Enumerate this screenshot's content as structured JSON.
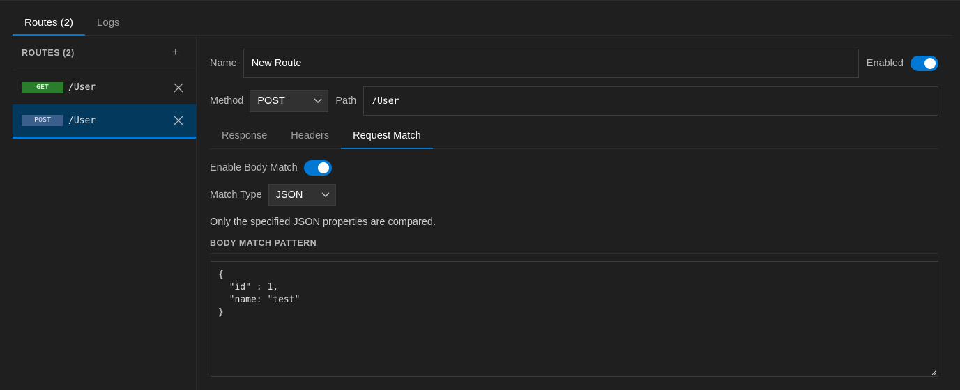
{
  "top_tabs": [
    {
      "label": "Routes (2)",
      "active": true
    },
    {
      "label": "Logs",
      "active": false
    }
  ],
  "sidebar": {
    "title": "ROUTES (2)",
    "add_label": "+",
    "routes": [
      {
        "method": "GET",
        "path": "/User",
        "selected": false
      },
      {
        "method": "POST",
        "path": "/User",
        "selected": true
      }
    ]
  },
  "route": {
    "name_label": "Name",
    "name_value": "New Route",
    "enabled_label": "Enabled",
    "enabled": true,
    "method_label": "Method",
    "method_value": "POST",
    "path_label": "Path",
    "path_value": "/User"
  },
  "sub_tabs": [
    {
      "label": "Response",
      "active": false
    },
    {
      "label": "Headers",
      "active": false
    },
    {
      "label": "Request Match",
      "active": true
    }
  ],
  "request_match": {
    "enable_body_match_label": "Enable Body Match",
    "enable_body_match": true,
    "match_type_label": "Match Type",
    "match_type_value": "JSON",
    "hint": "Only the specified JSON properties are compared.",
    "pattern_title": "BODY MATCH PATTERN",
    "pattern_value": "{\n  \"id\" : 1,\n  \"name: \"test\"\n}"
  },
  "colors": {
    "accent": "#0078d4",
    "get_badge": "#2a7d2a",
    "post_badge": "#3a5f8c",
    "selected_row": "#04395e",
    "background": "#1f1f1f"
  },
  "icons": {
    "remove": "close-icon",
    "dropdown": "chevron-down-icon",
    "add": "plus-icon"
  }
}
